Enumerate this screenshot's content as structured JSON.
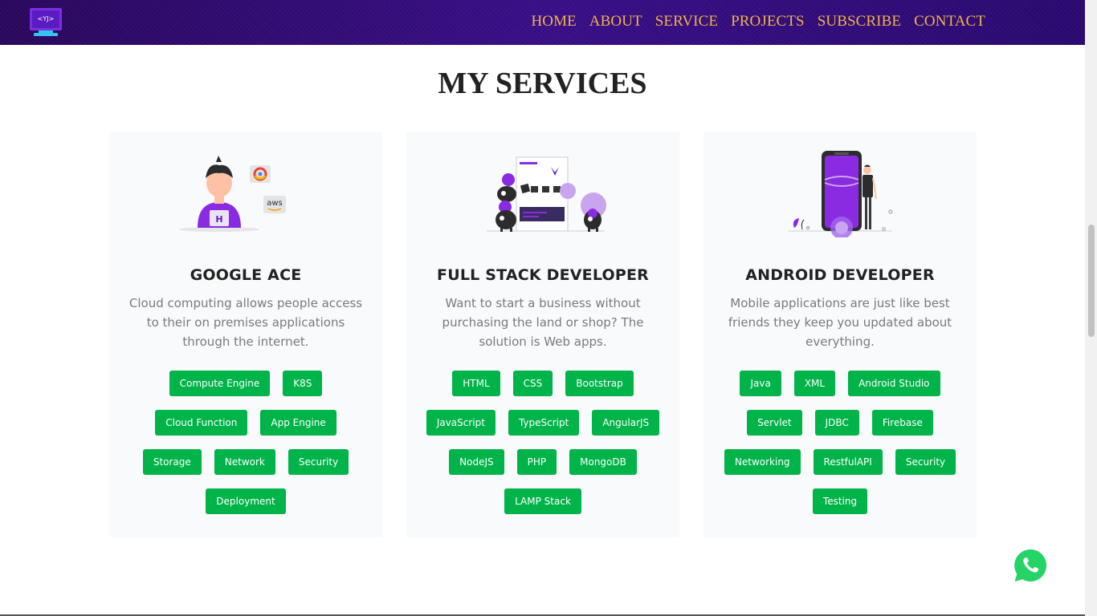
{
  "nav": {
    "logo_text": "<YJ>",
    "links": [
      "HOME",
      "ABOUT",
      "SERVICE",
      "PROJECTS",
      "SUBSCRIBE",
      "CONTACT"
    ]
  },
  "services": {
    "title": "MY SERVICES",
    "cards": [
      {
        "title": "GOOGLE ACE",
        "description": "Cloud computing allows people access to their on premises applications through the internet.",
        "illustration_labels": {
          "badge": "aws",
          "shirt": "H"
        },
        "tags": [
          [
            "Compute Engine",
            "K8S"
          ],
          [
            "Cloud Function",
            "App Engine"
          ],
          [
            "Storage",
            "Network",
            "Security"
          ],
          [
            "Deployment"
          ]
        ]
      },
      {
        "title": "FULL STACK DEVELOPER",
        "description": "Want to start a business without purchasing the land or shop? The solution is Web apps.",
        "tags": [
          [
            "HTML",
            "CSS",
            "Bootstrap"
          ],
          [
            "JavaScript",
            "TypeScript",
            "AngularJS"
          ],
          [
            "NodeJS",
            "PHP",
            "MongoDB"
          ],
          [
            "LAMP Stack"
          ]
        ]
      },
      {
        "title": "ANDROID DEVELOPER",
        "description": "Mobile applications are just like best friends they keep you updated about everything.",
        "tags": [
          [
            "Java",
            "XML",
            "Android Studio"
          ],
          [
            "Servlet",
            "JDBC",
            "Firebase"
          ],
          [
            "Networking",
            "RestfulAPI",
            "Security"
          ],
          [
            "Testing"
          ]
        ]
      }
    ]
  },
  "colors": {
    "accent": "#00b449",
    "nav_link": "#f2b24a",
    "nav_bg": "#2a0a6a",
    "brand_purple": "#8a2be2"
  },
  "icons": {
    "floating_action": "whatsapp-icon"
  }
}
